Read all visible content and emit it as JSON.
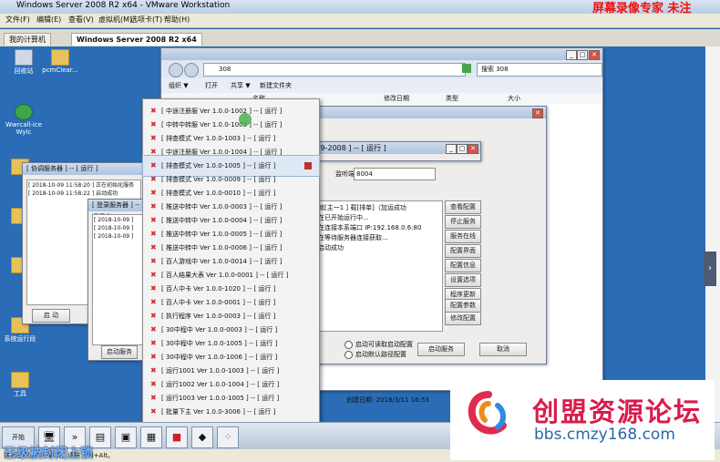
{
  "vm": {
    "title": "Windows Server 2008 R2 x64 - VMware Workstation",
    "menu": [
      "文件(F)",
      "编辑(E)",
      "查看(V)",
      "虚拟机(M)",
      "选项卡(T)",
      "帮助(H)"
    ],
    "tabs": [
      "我的计算机",
      "Windows Server 2008 R2 x64"
    ],
    "status_hint": "要返回到您的计算机，请按 Ctrl+Alt。"
  },
  "overlay": {
    "top_red": "屏幕录像专家 未注",
    "caption": "已级被封闭上锁"
  },
  "desktop_icons": [
    "回收站",
    "pcmClear...",
    "Wwrcall-ice Wylc",
    "系统运行段",
    "工具"
  ],
  "explorer": {
    "address": "308",
    "search": "搜索 308",
    "toolbar": [
      "组织 ▼",
      "打开",
      "共享 ▼",
      "新建文件夹"
    ],
    "columns": [
      "名称",
      "修改日期",
      "类型",
      "大小"
    ]
  },
  "dialog": {
    "title_suffix": "-0.9-2008 ] -- [ 运行 ]",
    "port_label": "监听端口：",
    "port_value": "8004",
    "log_lines": [
      "就[主一1 ] 载[排单]（加运成功",
      "在已开始运行中...",
      "在连接本系端口 IP:192.168.0.6:80",
      "",
      "在等待服务器连接获取...",
      "启动成功"
    ],
    "buttons": [
      "查看配置",
      "停止服务",
      "服务在线",
      "配置界面",
      "配置信息",
      "设置选项",
      "程序更新",
      "配置参数",
      "修改配置"
    ],
    "radio1": "启动可读取启动配置",
    "radio2": "启动默认路径配置",
    "btn_start": "启动服务",
    "btn_cancel": "取消",
    "created": "创建日期: 2018/3/11 16:53"
  },
  "left_windows": [
    {
      "title": "[ 协调服务器 ] -- [ 运行 ]",
      "lines": [
        "[ 2018-10-09 11:58:20 ] 正在初始化服务",
        "[ 2018-10-09 11:58:22 ] 启动成功"
      ],
      "button": "启 动"
    },
    {
      "title": "[ 登录服务器 ] -- [ 运行 ]",
      "lines": [
        "[ 2018-10-09 ]",
        "[ 2018-10-09 ]",
        "[ 2018-10-09 ]"
      ],
      "button": "启动服务"
    }
  ],
  "context_menu": [
    "[ 中途注册服 Ver 1.0.0-1002 ] -- [ 运行 ]",
    "[ 中转中转服 Ver 1.0.0-1003 ] -- [ 运行 ]",
    "[ 排查模式 Ver 1.0.0-1003 ] -- [ 运行 ]",
    "[ 中途注册服 Ver 1.0.0-1004 ] -- [ 运行 ]",
    "[ 排查模式 Ver 1.0.0-1005 ] -- [ 运行 ]",
    "[ 排查模式 Ver 1.0.0-0009 ] -- [ 运行 ]",
    "[ 排查模式 Ver 1.0.0-0010 ] -- [ 运行 ]",
    "[ 推送中转中 Ver 1.0.0-0003 ] -- [ 运行 ]",
    "[ 推送中转中 Ver 1.0.0-0004 ] -- [ 运行 ]",
    "[ 推送中转中 Ver 1.0.0-0005 ] -- [ 运行 ]",
    "[ 推送中转中 Ver 1.0.0-0006 ] -- [ 运行 ]",
    "[ 百人游戏中 Ver 1.0.0-0014 ] -- [ 运行 ]",
    "[ 百人结果大表 Ver 1.0.0-0001 ] -- [ 运行 ]",
    "[ 百人中卡 Ver 1.0.0-1020 ] -- [ 运行 ]",
    "[ 百人中卡 Ver 1.0.0-0001 ] -- [ 运行 ]",
    "[ 执行程序 Ver 1.0.0-0003 ] -- [ 运行 ]",
    "[ 30中程中 Ver 1.0.0-0003 ] -- [ 运行 ]",
    "[ 30中程中 Ver 1.0.0-1005 ] -- [ 运行 ]",
    "[ 30中程中 Ver 1.0.0-1006 ] -- [ 运行 ]",
    "[ 运行1001 Ver 1.0.0-1003 ] -- [ 运行 ]",
    "[ 运行1002 Ver 1.0.0-1004 ] -- [ 运行 ]",
    "[ 运行1003 Ver 1.0.0-1005 ] -- [ 运行 ]",
    "[ 批量下主 Ver 1.0.0-3006 ] -- [ 运行 ]"
  ],
  "taskbar": {
    "start": "开始"
  },
  "watermark": {
    "main": "创盟资源论坛",
    "url": "bbs.cmzy168.com"
  }
}
